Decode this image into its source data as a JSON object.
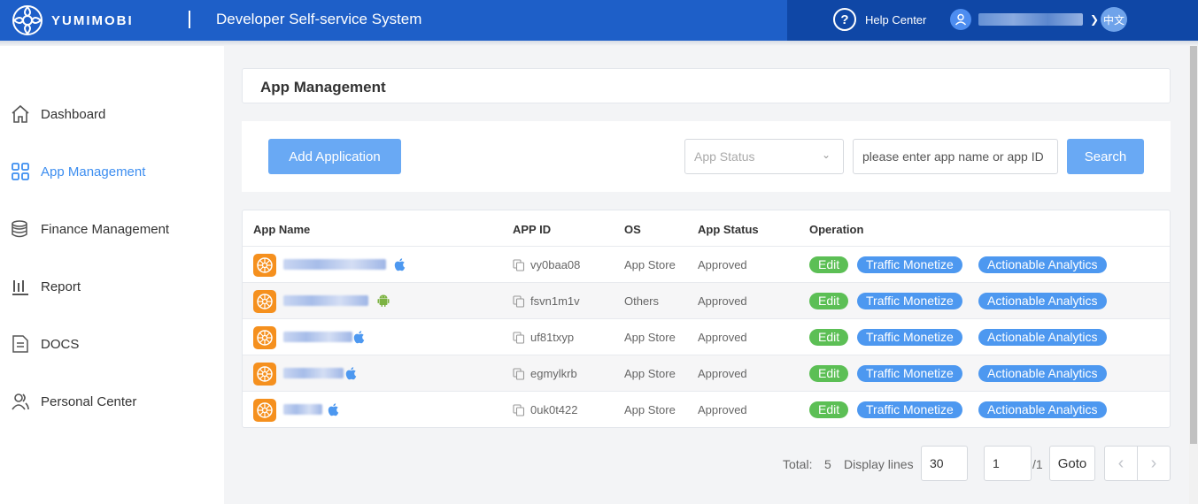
{
  "header": {
    "logo_text": "YUMIMOBI",
    "system_title": "Developer Self-service System",
    "help_label": "Help Center",
    "help_icon": "question-circle-icon",
    "language_label": "中文"
  },
  "sidebar": {
    "items": [
      {
        "label": "Dashboard",
        "icon": "home-icon",
        "active": false
      },
      {
        "label": "App Management",
        "icon": "grid-icon",
        "active": true
      },
      {
        "label": "Finance Management",
        "icon": "coins-icon",
        "active": false
      },
      {
        "label": "Report",
        "icon": "bar-chart-icon",
        "active": false
      },
      {
        "label": "DOCS",
        "icon": "document-icon",
        "active": false
      },
      {
        "label": "Personal Center",
        "icon": "user-icon",
        "active": false
      }
    ]
  },
  "page": {
    "title": "App Management"
  },
  "toolbar": {
    "add_label": "Add Application",
    "status_placeholder": "App Status",
    "search_placeholder": "please enter app name or app ID",
    "search_label": "Search"
  },
  "table": {
    "headers": {
      "name": "App Name",
      "id": "APP ID",
      "os": "OS",
      "status": "App Status",
      "operation": "Operation"
    },
    "rows": [
      {
        "app_id": "vy0baa08",
        "os": "App Store",
        "status": "Approved",
        "os_icon": "apple-icon"
      },
      {
        "app_id": "fsvn1m1v",
        "os": "Others",
        "status": "Approved",
        "os_icon": "android-icon"
      },
      {
        "app_id": "uf81txyp",
        "os": "App Store",
        "status": "Approved",
        "os_icon": "apple-icon"
      },
      {
        "app_id": "egmylkrb",
        "os": "App Store",
        "status": "Approved",
        "os_icon": "apple-icon"
      },
      {
        "app_id": "0uk0t422",
        "os": "App Store",
        "status": "Approved",
        "os_icon": "apple-icon"
      }
    ],
    "actions": {
      "edit": "Edit",
      "traffic": "Traffic Monetize",
      "analytics": "Actionable Analytics"
    }
  },
  "pagination": {
    "total_label": "Total:",
    "total_value": "5",
    "display_lines_label": "Display lines",
    "display_lines_value": "30",
    "page_value": "1",
    "page_total": "/1",
    "goto_label": "Goto"
  },
  "colors": {
    "topbar": "#1e5fc8",
    "topbar_right": "#0f47a6",
    "accent": "#4d98f0",
    "edit_green": "#5cbf55",
    "app_icon_orange": "#f5901e"
  }
}
